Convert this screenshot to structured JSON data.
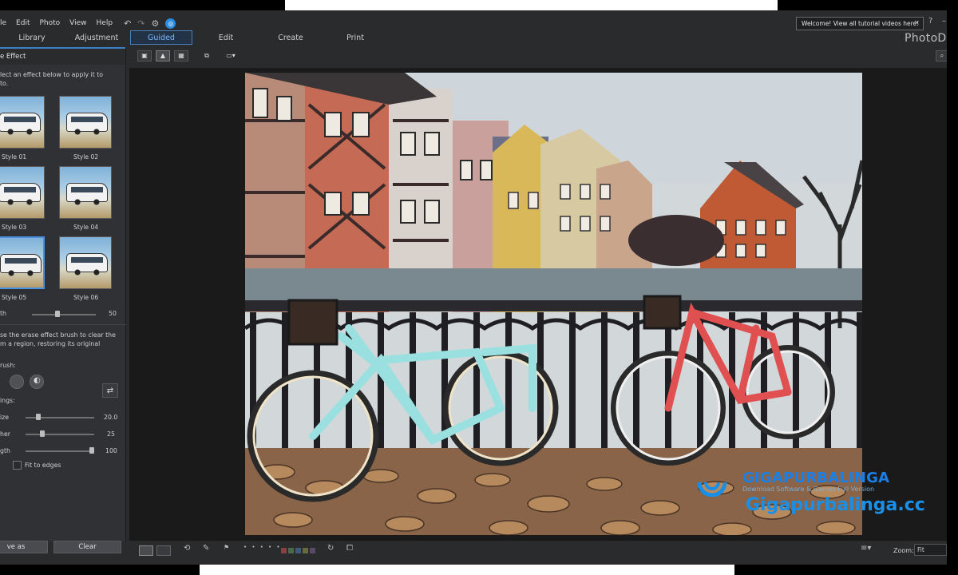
{
  "menu": [
    "le",
    "Edit",
    "Photo",
    "View",
    "Help"
  ],
  "tutorial": {
    "text": "Welcome! View all tutorial videos here!",
    "close": "×"
  },
  "help_label": "?",
  "window_min": "–",
  "tabs": [
    {
      "label": "Library",
      "active": false
    },
    {
      "label": "Adjustment",
      "active": false
    },
    {
      "label": "Guided",
      "active": true
    },
    {
      "label": "Edit",
      "active": false
    },
    {
      "label": "Create",
      "active": false
    },
    {
      "label": "Print",
      "active": false
    }
  ],
  "brand": "PhotoDi",
  "panel": {
    "header": "e Effect",
    "instruction_1": "lect an effect below to apply it to",
    "instruction_2": "to.",
    "styles": [
      {
        "label": "Style 01"
      },
      {
        "label": "Style 02"
      },
      {
        "label": "Style 03"
      },
      {
        "label": "Style 04"
      },
      {
        "label": "Style 05",
        "selected": true
      },
      {
        "label": "Style 06"
      }
    ],
    "strength": {
      "label": "th",
      "value": "50",
      "fraction": 0.5
    },
    "erase_line_1": "se the erase effect brush to clear the",
    "erase_line_2": "m a region, restoring its original",
    "erase_line_3": "",
    "brush_label": "rush:",
    "settings_label": "ings:",
    "size": {
      "label": "ize",
      "value": "20.0",
      "fraction": 0.2
    },
    "feather": {
      "label": "her",
      "value": "25",
      "fraction": 0.25
    },
    "strength2": {
      "label": "gth",
      "value": "100",
      "fraction": 1.0
    },
    "fit_to_edges": "Fit to edges",
    "save_as": "ve as",
    "clear": "Clear"
  },
  "zoom": {
    "label": "Zoom:",
    "value": "Fit"
  },
  "watermark": {
    "title": "GIGAPURBALINGA",
    "subtitle": "Download Software & Games Full Version",
    "url": "Gigapurbalinga.cc"
  },
  "colors": {
    "accent": "#3f7fc4",
    "tab_active": "#7fb7ff",
    "watermark": "#1a7fe6"
  },
  "icons": {
    "undo": "undo-icon",
    "redo": "redo-icon",
    "settings": "gear-icon",
    "notification": "notification-icon",
    "search": "search-icon",
    "rotate": "rotate-icon",
    "crop": "crop-icon",
    "flag": "flag-icon",
    "brush": "brush-icon"
  }
}
